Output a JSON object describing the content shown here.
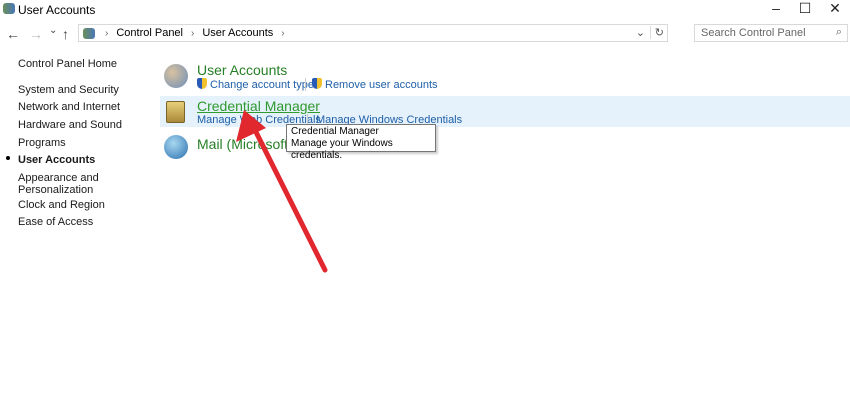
{
  "window": {
    "title": "User Accounts",
    "minimize": "–",
    "maximize": "☐",
    "close": "✕"
  },
  "nav": {
    "back": "←",
    "forward": "→",
    "recent": "⌄",
    "up": "↑",
    "refresh": "↻",
    "dropdown": "⌄"
  },
  "breadcrumb": [
    "Control Panel",
    "User Accounts"
  ],
  "search": {
    "placeholder": "Search Control Panel",
    "icon": "⌕"
  },
  "sidebar": [
    "Control Panel Home",
    "System and Security",
    "Network and Internet",
    "Hardware and Sound",
    "Programs",
    "User Accounts",
    "Appearance and Personalization",
    "Clock and Region",
    "Ease of Access"
  ],
  "categories": {
    "user_accounts": {
      "title": "User Accounts",
      "links": [
        "Change account type",
        "Remove user accounts"
      ]
    },
    "credential_manager": {
      "title": "Credential Manager",
      "links": [
        "Manage Web Credentials",
        "Manage Windows Credentials"
      ]
    },
    "mail": {
      "title": "Mail (Microsoft Outlook)"
    }
  },
  "tooltip": {
    "title": "Credential Manager",
    "text": "Manage your Windows credentials."
  },
  "colors": {
    "accent": "#267f26",
    "link": "#1e5fa8",
    "arrow": "#e0282e"
  }
}
